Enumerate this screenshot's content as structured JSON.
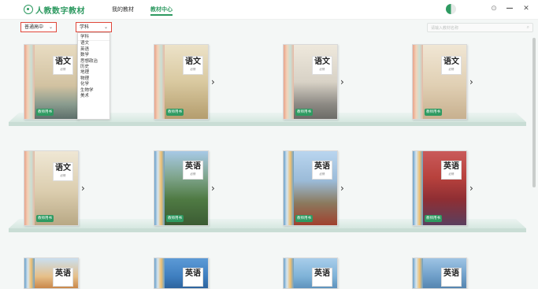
{
  "app": {
    "title": "人教数字教材"
  },
  "nav": {
    "items": [
      "我的教材",
      "教材中心"
    ],
    "active": "教材中心"
  },
  "filters": {
    "stage": "普通高中",
    "subject": "学科"
  },
  "search": {
    "placeholder": "请输入教材名称"
  },
  "subject_dropdown": {
    "options": [
      "学科",
      "语文",
      "英语",
      "数学",
      "思想政治",
      "历史",
      "地理",
      "物理",
      "化学",
      "生物学",
      "美术"
    ]
  },
  "books": [
    {
      "title": "语文",
      "tag": "教师用书",
      "accent": "#c9a47a"
    },
    {
      "title": "语文",
      "tag": "教师用书",
      "accent": "#b59d7a"
    },
    {
      "title": "语文",
      "tag": "教师用书",
      "accent": "#9b8e7f"
    },
    {
      "title": "语文",
      "tag": "教师用书",
      "accent": "#c4ab8a"
    },
    {
      "title": "语文",
      "tag": "教师用书",
      "accent": "#c2b394"
    },
    {
      "title": "英语",
      "tag": "教师用书",
      "accent": "#3f7d4c"
    },
    {
      "title": "英语",
      "tag": "教师用书",
      "accent": "#6fa6d6"
    },
    {
      "title": "英语",
      "tag": "教师用书",
      "accent": "#c0392b"
    },
    {
      "title": "英语",
      "tag": "",
      "accent": "#d8a06a"
    },
    {
      "title": "英语",
      "tag": "",
      "accent": "#4a86c5"
    },
    {
      "title": "英语",
      "tag": "",
      "accent": "#7fb3d8"
    },
    {
      "title": "英语",
      "tag": "",
      "accent": "#6f9fc9"
    }
  ],
  "colors": {
    "brand": "#2e9a61",
    "filter_border": "#e0473a",
    "background": "#f4f7f6"
  },
  "icons": [
    "logo-icon",
    "user-avatar",
    "settings-icon",
    "minimize-icon",
    "close-icon",
    "search-icon",
    "chevron-down-icon",
    "chevron-right-icon"
  ]
}
